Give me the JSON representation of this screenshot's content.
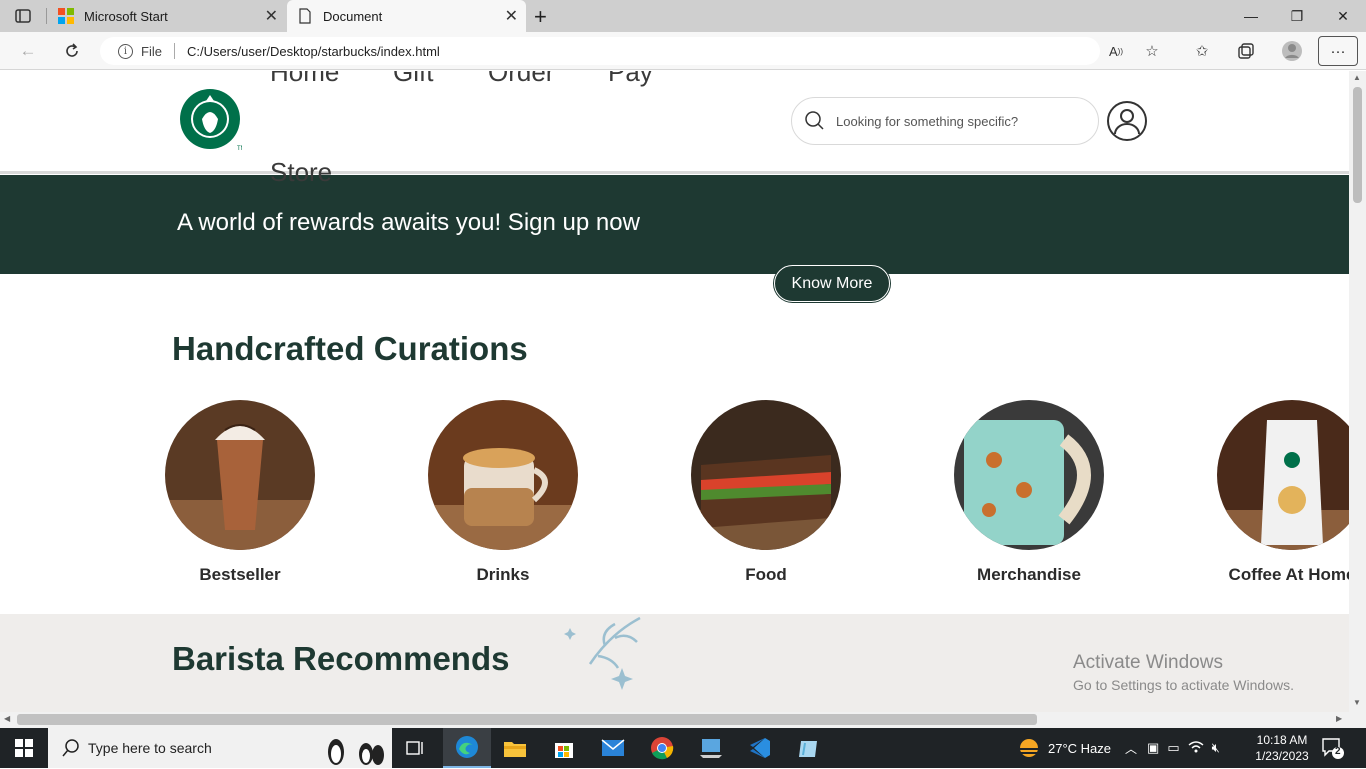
{
  "browser": {
    "tabs": [
      {
        "title": "Microsoft Start",
        "active": false
      },
      {
        "title": "Document",
        "active": true
      }
    ],
    "address": {
      "scheme_label": "File",
      "url": "C:/Users/user/Desktop/starbucks/index.html"
    }
  },
  "page": {
    "nav": [
      "Home",
      "Gift",
      "Order",
      "Pay",
      "Store"
    ],
    "search_placeholder": "Looking for something specific?",
    "banner_text": "A world of rewards awaits you! Sign up now",
    "know_more": "Know More",
    "section_title": "Handcrafted Curations",
    "categories": [
      {
        "label": "Bestseller"
      },
      {
        "label": "Drinks"
      },
      {
        "label": "Food"
      },
      {
        "label": "Merchandise"
      },
      {
        "label": "Coffee At Home"
      }
    ],
    "barista_title": "Barista Recommends",
    "brand_color": "#1e3932"
  },
  "watermark": {
    "line1": "Activate Windows",
    "line2": "Go to Settings to activate Windows."
  },
  "taskbar": {
    "search_placeholder": "Type here to search",
    "weather": "27°C  Haze",
    "time": "10:18 AM",
    "date": "1/23/2023",
    "notifications": "2"
  }
}
